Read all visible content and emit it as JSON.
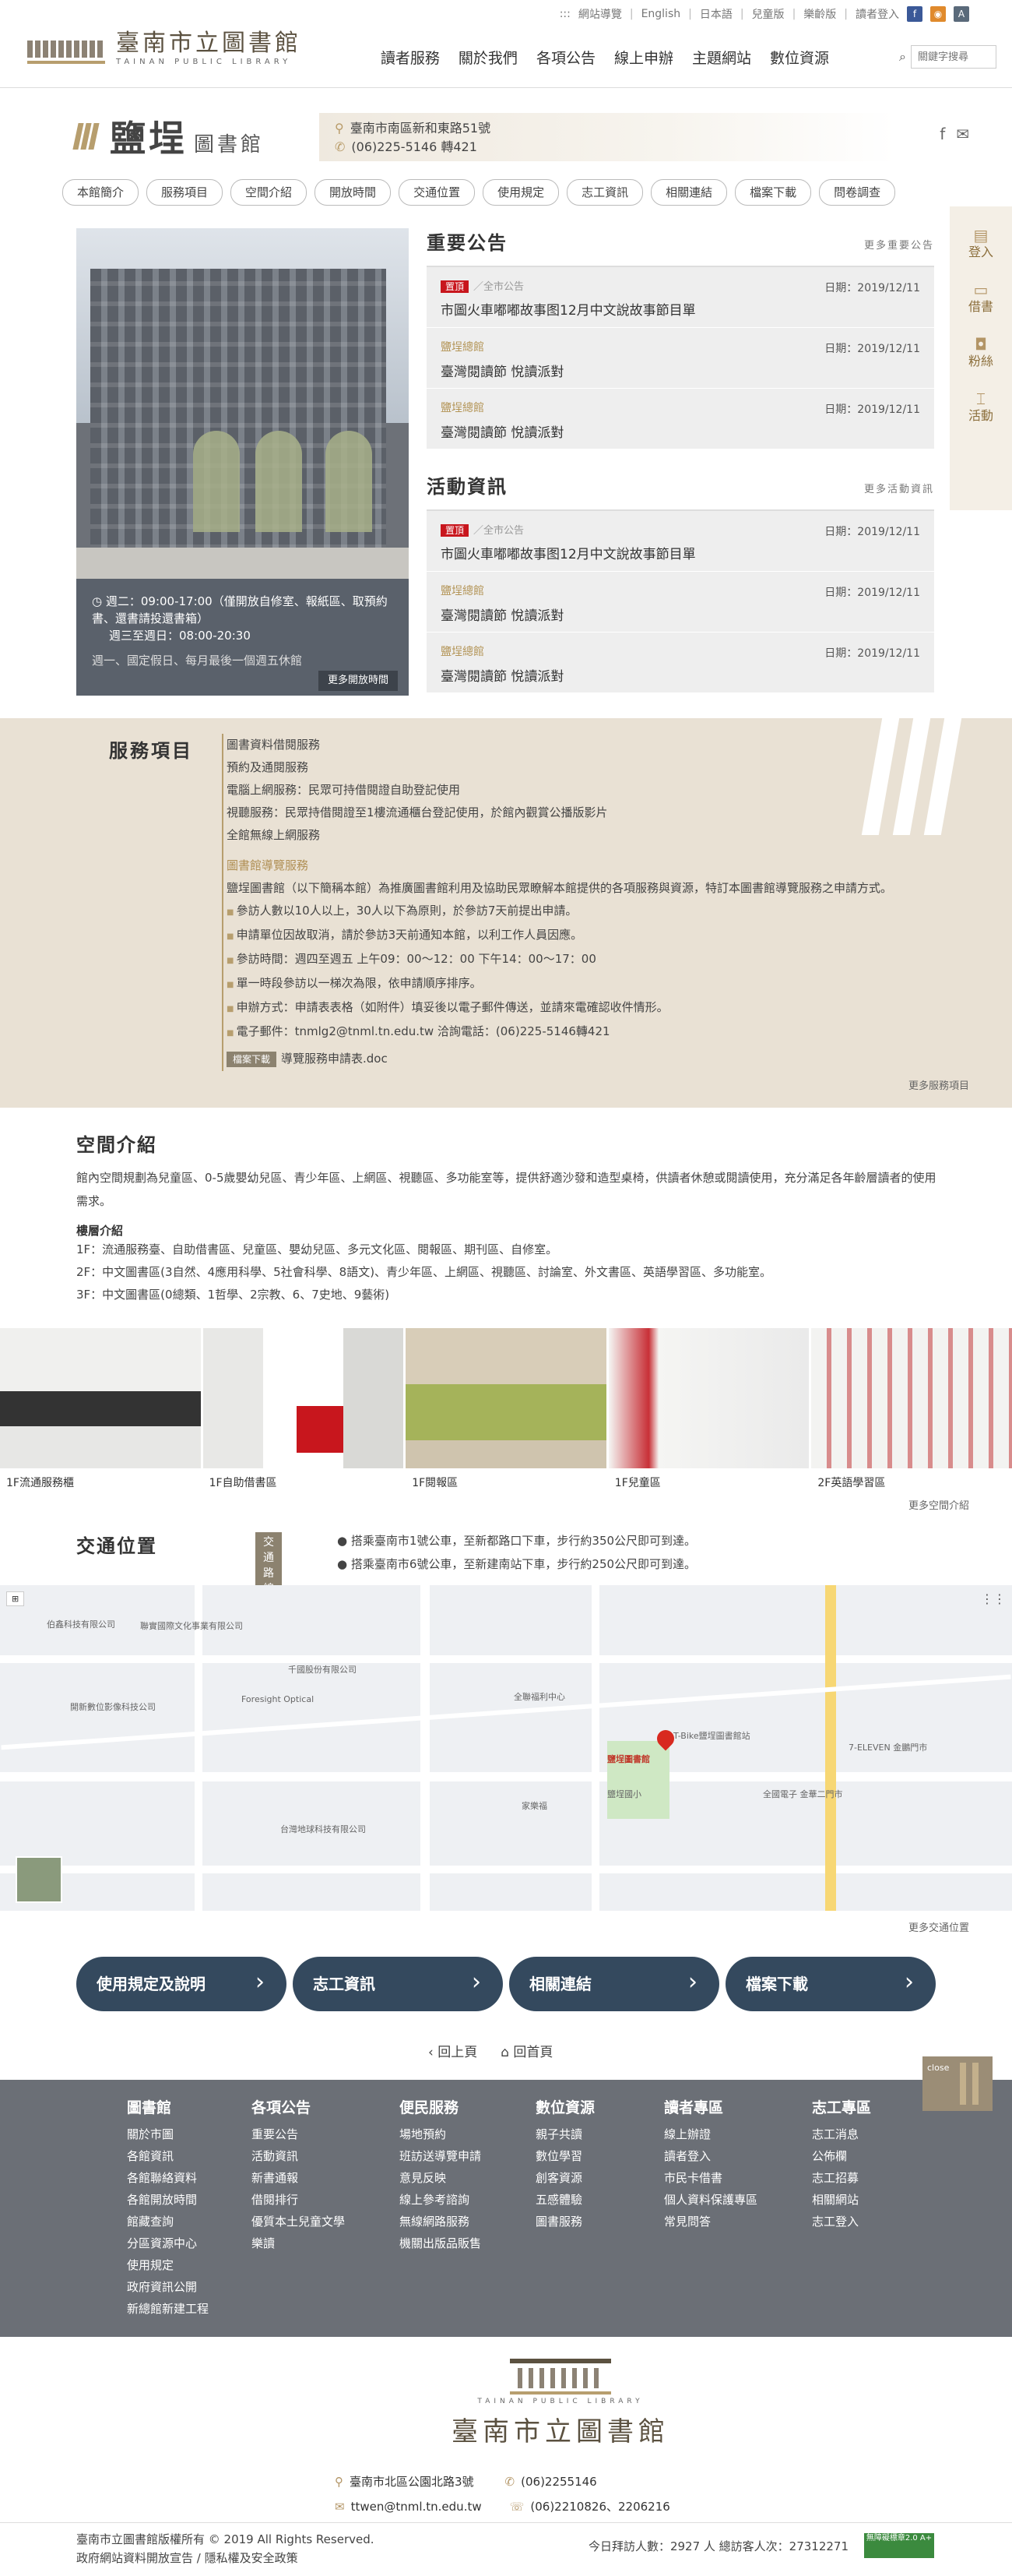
{
  "topbar": {
    "links": [
      "網站導覽",
      "English",
      "日本語",
      "兒童版",
      "樂齡版",
      "讀者登入"
    ],
    "prefix": ":::"
  },
  "logo": {
    "title": "臺南市立圖書館",
    "subtitle": "TAINAN PUBLIC LIBRARY"
  },
  "nav": [
    "讀者服務",
    "關於我們",
    "各項公告",
    "線上申辦",
    "主題網站",
    "數位資源"
  ],
  "search": {
    "placeholder": "關鍵字搜尋"
  },
  "branch": {
    "name": "鹽埕",
    "suffix": "圖書館",
    "address": "臺南市南區新和東路51號",
    "phone": "(06)225-5146 轉421"
  },
  "subnav": [
    "本館簡介",
    "服務項目",
    "空間介紹",
    "開放時間",
    "交通位置",
    "使用規定",
    "志工資訊",
    "相關連結",
    "檔案下載",
    "問卷調查"
  ],
  "hours": {
    "line1": "週二：09:00-17:00（僅開放自修室、報紙區、取預約書、還書請投還書箱）",
    "line2": "週三至週日：08:00-20:30",
    "line3": "週一、國定假日、每月最後一個週五休館",
    "more": "更多開放時間"
  },
  "notices": {
    "title": "重要公告",
    "more": "更多重要公告",
    "items": [
      {
        "tag": "置頂",
        "cat": "全市公告",
        "date": "日期：2019/12/11",
        "title": "市圖火車嘟嘟故事图12月中文說故事節目單"
      },
      {
        "cat": "鹽埕總館",
        "date": "日期：2019/12/11",
        "title": "臺灣閱讀節 悅讀派對"
      },
      {
        "cat": "鹽埕總館",
        "date": "日期：2019/12/11",
        "title": "臺灣閱讀節 悅讀派對"
      }
    ]
  },
  "events": {
    "title": "活動資訊",
    "more": "更多活動資訊",
    "items": [
      {
        "tag": "置頂",
        "cat": "全市公告",
        "date": "日期：2019/12/11",
        "title": "市圖火車嘟嘟故事图12月中文說故事節目單"
      },
      {
        "cat": "鹽埕總館",
        "date": "日期：2019/12/11",
        "title": "臺灣閱讀節 悅讀派對"
      },
      {
        "cat": "鹽埕總館",
        "date": "日期：2019/12/11",
        "title": "臺灣閱讀節 悅讀派對"
      }
    ]
  },
  "side": [
    "登入",
    "借書",
    "粉絲",
    "活動"
  ],
  "services": {
    "title": "服務項目",
    "items": [
      "圖書資料借閱服務",
      "預約及通閱服務",
      "電腦上網服務：民眾可持借閱證自助登記使用",
      "視聽服務：民眾持借閱證至1樓流通櫃台登記使用，於館內觀賞公播版影片",
      "全館無線上網服務"
    ],
    "guide_title": "圖書館導覽服務",
    "guide_text": "鹽埕圖書館（以下簡稱本館）為推廣圖書館利用及協助民眾瞭解本館提供的各項服務與資源，特訂本圖書館導覽服務之申請方式。",
    "bullets": [
      "參訪人數以10人以上，30人以下為原則，於參訪7天前提出申請。",
      "申請單位因故取消，請於參訪3天前通知本館，以利工作人員因應。",
      "參訪時間：週四至週五 上午09：00～12：00 下午14：00～17：00",
      "單一時段參訪以一梯次為限，依申請順序排序。",
      "申辦方式：申請表表格（如附件）填妥後以電子郵件傳送，並請來電確認收件情形。",
      "電子郵件：tnmlg2@tnml.tn.edu.tw 洽詢電話：(06)225-5146轉421"
    ],
    "download_tag": "檔案下載",
    "download": "導覽服務申請表.doc",
    "more": "更多服務項目"
  },
  "space": {
    "title": "空間介紹",
    "desc": "館內空間規劃為兒童區、0-5歲嬰幼兒區、青少年區、上網區、視聽區、多功能室等，提供舒適沙發和造型桌椅，供讀者休憩或閱讀使用，充分滿足各年齡層讀者的使用需求。",
    "floor_title": "樓層介紹",
    "floors": [
      "1F：流通服務臺、自助借書區、兒童區、嬰幼兒區、多元文化區、閱報區、期刊區、自修室。",
      "2F：中文圖書區(3自然、4應用科學、5社會科學、8語文)、青少年區、上網區、視聽區、討論室、外文書區、英語學習區、多功能室。",
      "3F：中文圖書區(0總類、1哲學、2宗教、6、7史地、9藝術)"
    ],
    "photos": [
      "1F流通服務櫃",
      "1F自助借書區",
      "1F閱報區",
      "1F兒童區",
      "2F英語學習區"
    ],
    "more": "更多空間介紹"
  },
  "traffic": {
    "title": "交通位置",
    "badge": "交通路線",
    "lines": [
      "搭乘臺南市1號公車，至新都路口下車，步行約350公尺即可到達。",
      "搭乘臺南市6號公車，至新建南站下車，步行約250公尺即可到達。"
    ],
    "more": "更多交通位置",
    "map_labels": [
      "鹽埕圖書館",
      "T-Bike鹽埕圖書館站",
      "7-ELEVEN 金鵬門市",
      "全國電子 金華二門市",
      "伯鑫科技有限公司",
      "聯實國際文化事業有限公司",
      "Foresight Optical",
      "開新數位影像科技公司",
      "千國股份有限公司",
      "台灣地球科技有限公司",
      "家樂福",
      "全聯福利中心",
      "鹽埕國小"
    ]
  },
  "quick": [
    "使用規定及說明",
    "志工資訊",
    "相關連結",
    "檔案下載"
  ],
  "back": {
    "prev": "回上頁",
    "home": "回首頁"
  },
  "footer": {
    "cols": [
      {
        "title": "圖書館",
        "items": [
          "關於市圖",
          "各館資訊",
          "各館聯絡資料",
          "各館開放時間",
          "館藏查詢",
          "分區資源中心",
          "使用規定",
          "政府資訊公開",
          "新總館新建工程"
        ]
      },
      {
        "title": "各項公告",
        "items": [
          "重要公告",
          "活動資訊",
          "新書通報",
          "借閱排行",
          "優質本土兒童文學",
          "樂讀"
        ]
      },
      {
        "title": "便民服務",
        "items": [
          "場地預約",
          "班訪送導覽申請",
          "意見反映",
          "線上參考諮詢",
          "無線網路服務",
          "機關出版品販售"
        ]
      },
      {
        "title": "數位資源",
        "items": [
          "親子共讀",
          "數位學習",
          "創客資源",
          "五感體驗",
          "圖書服務"
        ]
      },
      {
        "title": "讀者專區",
        "items": [
          "線上辦證",
          "讀者登入",
          "市民卡借書",
          "個人資料保護專區",
          "常見問答"
        ]
      },
      {
        "title": "志工專區",
        "items": [
          "志工消息",
          "公佈欄",
          "志工招募",
          "相關網站",
          "志工登入"
        ]
      }
    ],
    "close": "close"
  },
  "bottom": {
    "address": "臺南市北區公園北路3號",
    "phone": "(06)2255146",
    "email": "ttwen@tnml.tn.edu.tw",
    "fax": "(06)2210826、2206216",
    "copyright": "臺南市立圖書館版權所有 © 2019 All Rights Reserved.",
    "policy": "政府網站資料開放宣告 / 隱私權及安全政策",
    "visitors": "今日拜訪人數：2927 人  總訪客人次：27312271",
    "cert": "無障礙標章2.0 A+"
  }
}
